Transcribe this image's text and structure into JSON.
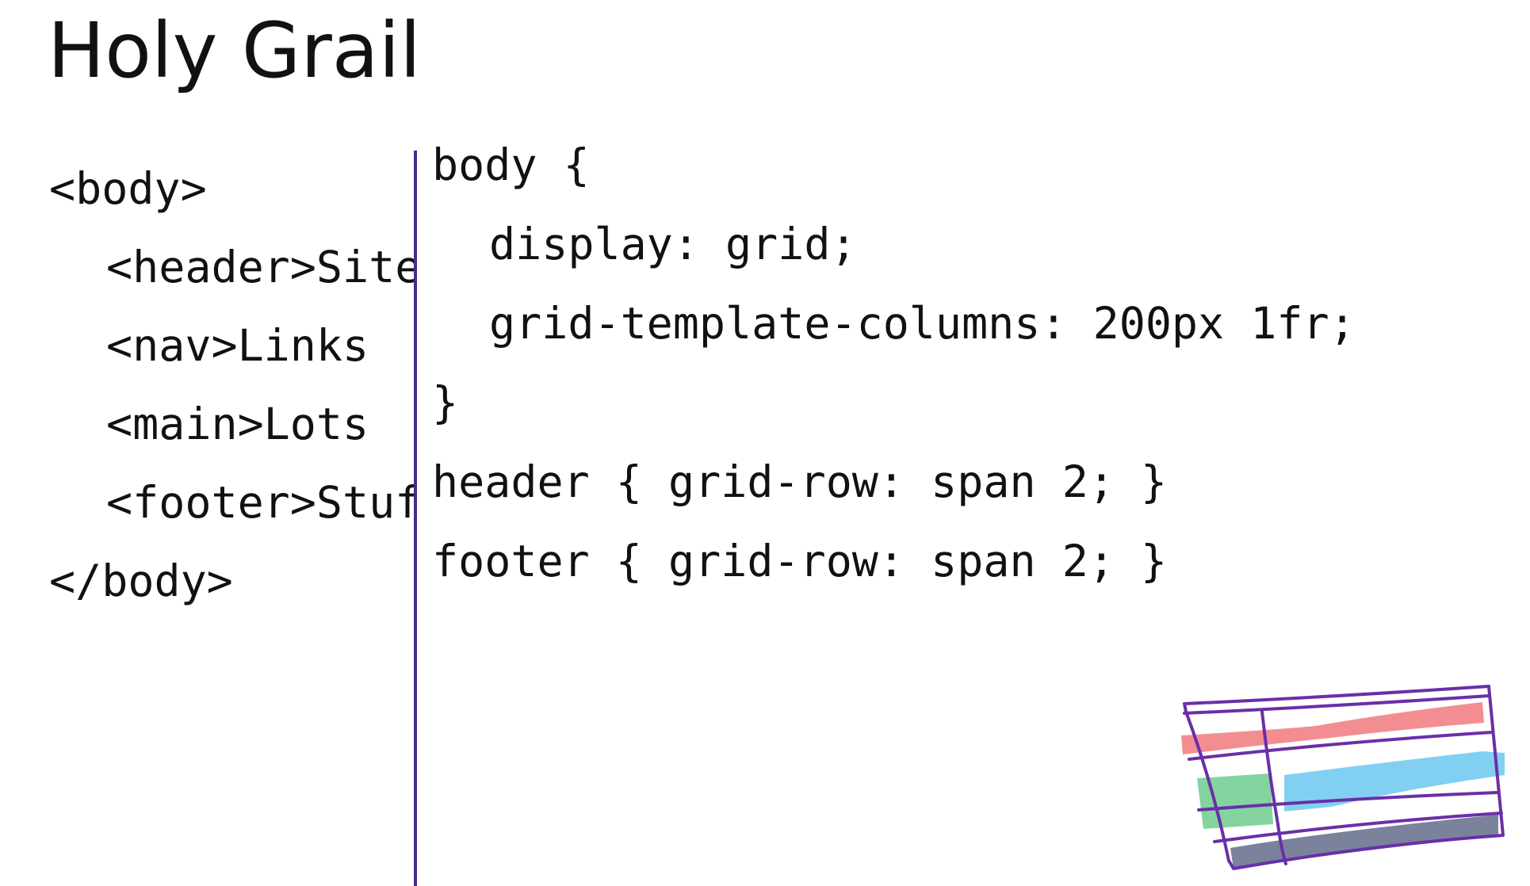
{
  "slide": {
    "title": "Holy Grail"
  },
  "html_code": {
    "lines": [
      "<body>",
      "<header>Site",
      "<nav>Links",
      "<main>Lots",
      "<footer>Stuff",
      "</body>"
    ]
  },
  "css_code": {
    "lines": [
      "body {",
      "display: grid;",
      "grid-template-columns: 200px 1fr;",
      "}",
      "header { grid-row: span 2; }",
      "footer { grid-row: span 2; }"
    ]
  },
  "sketch": {
    "outline_color": "#6a2fa8",
    "header_color": "#f07a7e",
    "nav_color": "#6fcc8f",
    "main_color": "#6cc8ef",
    "footer_color": "#6b7491"
  }
}
